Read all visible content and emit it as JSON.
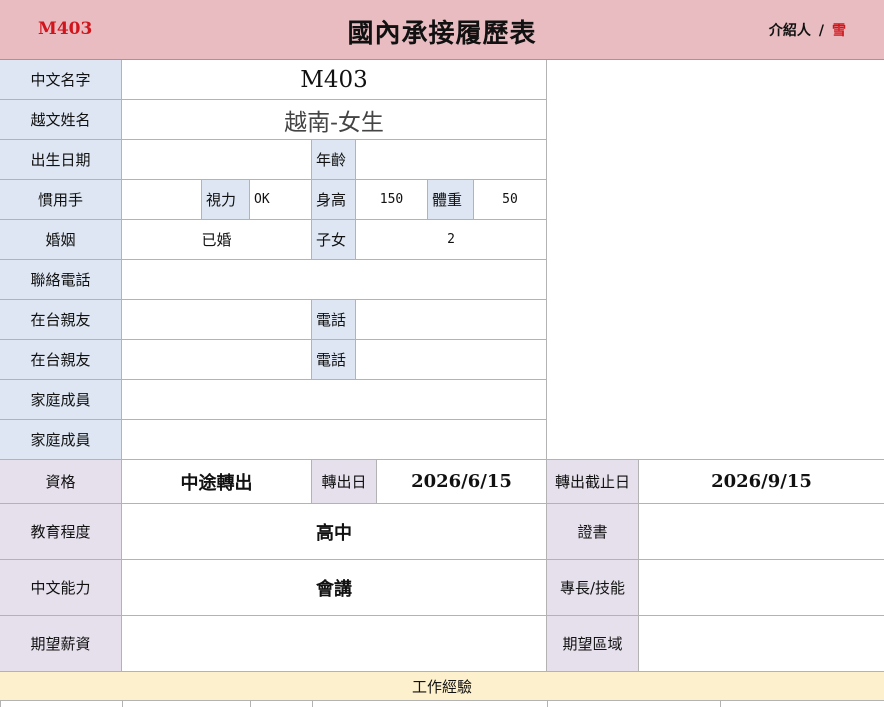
{
  "header": {
    "code": "M403",
    "title": "國內承接履歷表",
    "introducer_label": "介紹人",
    "separator": "/",
    "introducer_name": "雪"
  },
  "rows": {
    "chinese_name": {
      "label": "中文名字",
      "value": "M403"
    },
    "vietnamese_name": {
      "label": "越文姓名",
      "value": "越南-女生"
    },
    "birth": {
      "label": "出生日期",
      "value": "",
      "age_label": "年齡",
      "age_value": ""
    },
    "hand": {
      "label": "慣用手",
      "value": "",
      "vision_label": "視力",
      "vision_value": "OK",
      "height_label": "身高",
      "height_value": "150",
      "weight_label": "體重",
      "weight_value": "50"
    },
    "marriage": {
      "label": "婚姻",
      "value": "已婚",
      "children_label": "子女",
      "children_value": "2"
    },
    "phone": {
      "label": "聯絡電話",
      "value": ""
    },
    "relative1": {
      "label": "在台親友",
      "value": "",
      "phone_label": "電話",
      "phone_value": ""
    },
    "relative2": {
      "label": "在台親友",
      "value": "",
      "phone_label": "電話",
      "phone_value": ""
    },
    "family1": {
      "label": "家庭成員",
      "value": ""
    },
    "family2": {
      "label": "家庭成員",
      "value": ""
    },
    "qualification": {
      "label": "資格",
      "value": "中途轉出",
      "transfer_date_label": "轉出日",
      "transfer_date_value": "2026/6/15",
      "deadline_label": "轉出截止日",
      "deadline_value": "2026/9/15"
    },
    "education": {
      "label": "教育程度",
      "value": "高中",
      "cert_label": "證書",
      "cert_value": ""
    },
    "chinese_ability": {
      "label": "中文能力",
      "value": "會講",
      "skill_label": "專長/技能",
      "skill_value": ""
    },
    "salary": {
      "label": "期望薪資",
      "value": "",
      "region_label": "期望區域",
      "region_value": ""
    }
  },
  "work_experience": {
    "label": "工作經驗"
  }
}
